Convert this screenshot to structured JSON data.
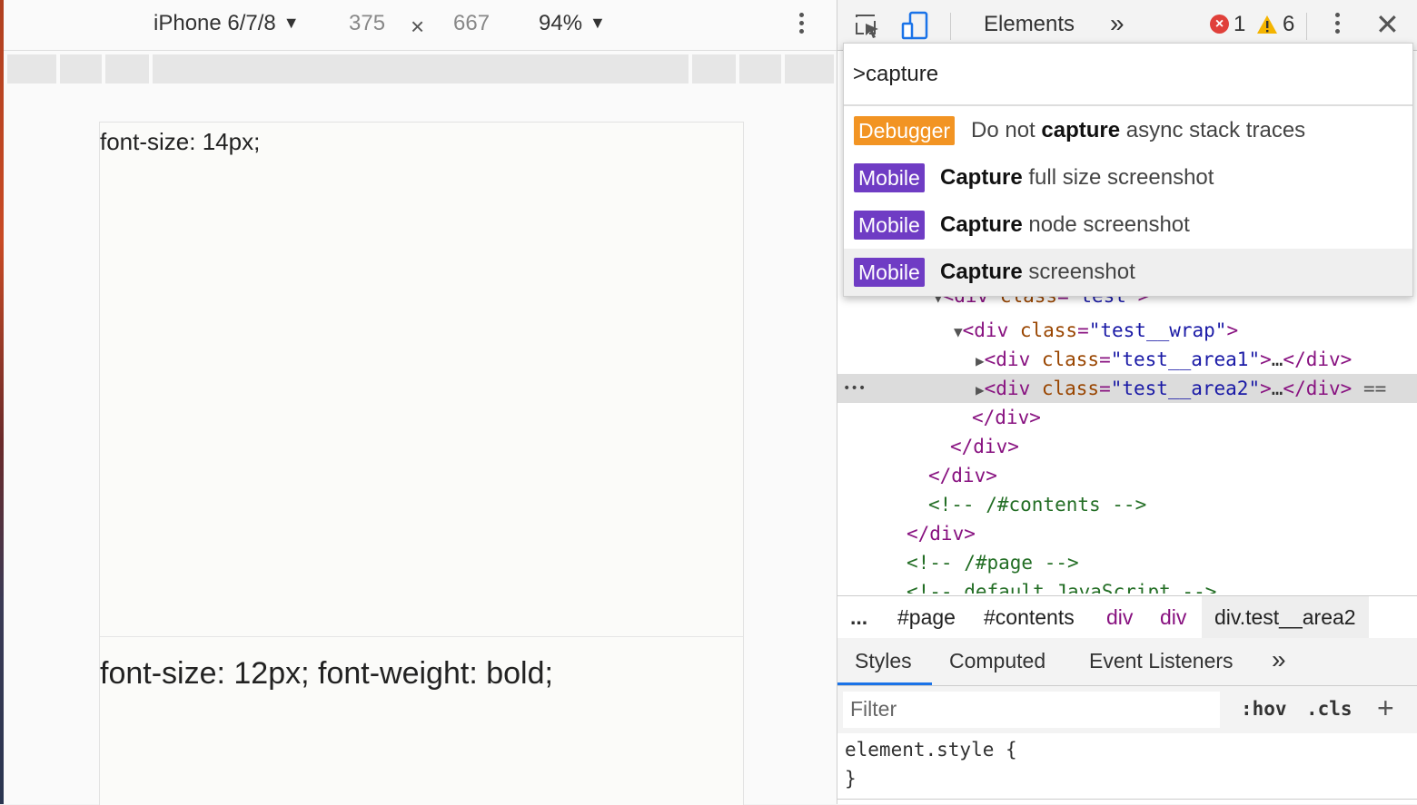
{
  "device_toolbar": {
    "device": "iPhone 6/7/8",
    "width": "375",
    "times": "×",
    "height": "667",
    "zoom": "94%",
    "caret": "▼"
  },
  "viewport": {
    "area1_text": "font-size: 14px;",
    "area2_text": "font-size: 12px; font-weight: bold;"
  },
  "devtools_toolbar": {
    "elements_tab": "Elements",
    "more_tabs": "»",
    "error_count": "1",
    "warning_count": "6",
    "close": "✕"
  },
  "command_menu": {
    "query": ">capture",
    "items": [
      {
        "badge": "Debugger",
        "pre": "Do not ",
        "bold": "capture",
        "post": " async stack traces"
      },
      {
        "badge": "Mobile",
        "pre": "",
        "bold": "Capture",
        "post": " full size screenshot"
      },
      {
        "badge": "Mobile",
        "pre": "",
        "bold": "Capture",
        "post": " node screenshot"
      },
      {
        "badge": "Mobile",
        "pre": "",
        "bold": "Capture",
        "post": " screenshot"
      }
    ]
  },
  "tree": {
    "l1": {
      "tag": "<div ",
      "attr": "class",
      "eq": "=",
      "val": "\"test\"",
      "close": ">"
    },
    "l2": {
      "tag": "<div ",
      "attr": "class",
      "eq": "=",
      "val": "\"test__wrap\"",
      "close": ">"
    },
    "l3": {
      "tag": "<div ",
      "attr": "class",
      "eq": "=",
      "val": "\"test__area1\"",
      "close": ">",
      "ellipsis": "…",
      "end": "</div>"
    },
    "l4": {
      "tag": "<div ",
      "attr": "class",
      "eq": "=",
      "val": "\"test__area2\"",
      "close": ">",
      "ellipsis": "…",
      "end": "</div>",
      "marker": "==",
      "dots": "•••"
    },
    "l5": "</div>",
    "l6": "</div>",
    "l7": "</div>",
    "l8": "<!-- /#contents -->",
    "l9": "</div>",
    "l10": "<!-- /#page -->",
    "l11": "<!-- default JavaScript -->"
  },
  "breadcrumbs": {
    "ellipsis": "...",
    "items": [
      "#page",
      "#contents",
      "div",
      "div",
      "div.test__area2"
    ]
  },
  "styles_tabs": {
    "styles": "Styles",
    "computed": "Computed",
    "listeners": "Event Listeners",
    "more": "»"
  },
  "filter": {
    "placeholder": "Filter",
    "hov": ":hov",
    "cls": ".cls",
    "plus": "+"
  },
  "rule": {
    "selector": "element.style {",
    "close": "}"
  },
  "colors": {
    "debugger_badge": "#f29423",
    "mobile_badge": "#6f3cc4",
    "tag": "#881280",
    "attr": "#994500",
    "value": "#1a1aa6",
    "comment": "#236e25",
    "accent": "#1a73e8"
  },
  "icons": [
    "inspect-icon",
    "device-toggle-icon",
    "error-icon",
    "warning-icon",
    "kebab-menu-icon",
    "close-icon"
  ]
}
